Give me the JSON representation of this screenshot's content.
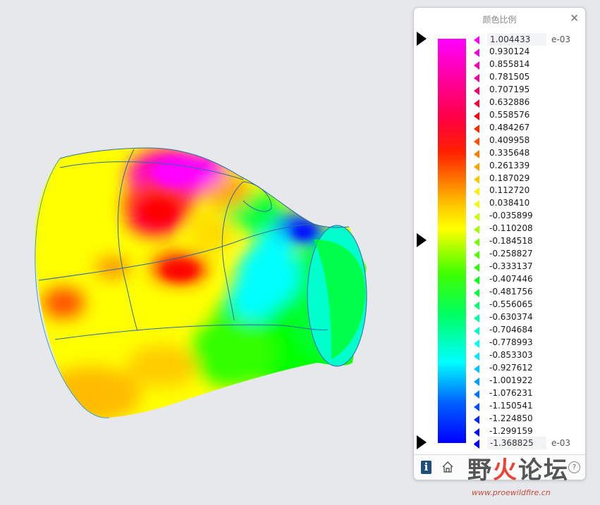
{
  "panel": {
    "title": "颜色比例",
    "close_icon": "close-icon",
    "max_value": "1.004433",
    "min_value": "-1.368825",
    "max_exponent": "e-03",
    "min_exponent": "e-03",
    "ticks": [
      {
        "label": "0.930124",
        "color": "#f000e0"
      },
      {
        "label": "0.855814",
        "color": "#f200c0"
      },
      {
        "label": "0.781505",
        "color": "#f400a0"
      },
      {
        "label": "0.707195",
        "color": "#f60070"
      },
      {
        "label": "0.632886",
        "color": "#f8003c"
      },
      {
        "label": "0.558576",
        "color": "#fa0010"
      },
      {
        "label": "0.484267",
        "color": "#fb2800"
      },
      {
        "label": "0.409958",
        "color": "#fc5000"
      },
      {
        "label": "0.335648",
        "color": "#fd7800"
      },
      {
        "label": "0.261339",
        "color": "#fea000"
      },
      {
        "label": "0.187029",
        "color": "#fec800"
      },
      {
        "label": "0.112720",
        "color": "#fff000"
      },
      {
        "label": "0.038410",
        "color": "#f0ff00"
      },
      {
        "label": "-0.035899",
        "color": "#c8ff00"
      },
      {
        "label": "-0.110208",
        "color": "#a0ff00"
      },
      {
        "label": "-0.184518",
        "color": "#78ff00"
      },
      {
        "label": "-0.258827",
        "color": "#50ff00"
      },
      {
        "label": "-0.333137",
        "color": "#28ff00"
      },
      {
        "label": "-0.407446",
        "color": "#00ff10"
      },
      {
        "label": "-0.481756",
        "color": "#00ff40"
      },
      {
        "label": "-0.556065",
        "color": "#00ff70"
      },
      {
        "label": "-0.630374",
        "color": "#00ffa0"
      },
      {
        "label": "-0.704684",
        "color": "#00ffc8"
      },
      {
        "label": "-0.778993",
        "color": "#00fff0"
      },
      {
        "label": "-0.853303",
        "color": "#00e8ff"
      },
      {
        "label": "-0.927612",
        "color": "#00c8ff"
      },
      {
        "label": "-1.001922",
        "color": "#00a0ff"
      },
      {
        "label": "-1.076231",
        "color": "#0078ff"
      },
      {
        "label": "-1.150541",
        "color": "#0050ff"
      },
      {
        "label": "-1.224850",
        "color": "#0028ff"
      },
      {
        "label": "-1.299159",
        "color": "#0010ff"
      },
      {
        "label": "",
        "color": "#0000e0"
      }
    ],
    "footer": {
      "info_icon": "info-icon",
      "info_glyph": "i",
      "home_icon": "home-icon",
      "help_icon": "help-icon",
      "help_glyph": "?"
    }
  },
  "watermark": {
    "brand_part1": "野",
    "brand_part2": "火",
    "brand_part3": "论坛",
    "url": "www.proewildfire.cn"
  },
  "colors": {
    "background": "#e7e8eb",
    "gradient_top": "#ff00ff",
    "gradient_red": "#ff0000",
    "gradient_yellow": "#ffff00",
    "gradient_green": "#00ff00",
    "gradient_cyan": "#00ffff",
    "gradient_blue": "#0000ff"
  }
}
